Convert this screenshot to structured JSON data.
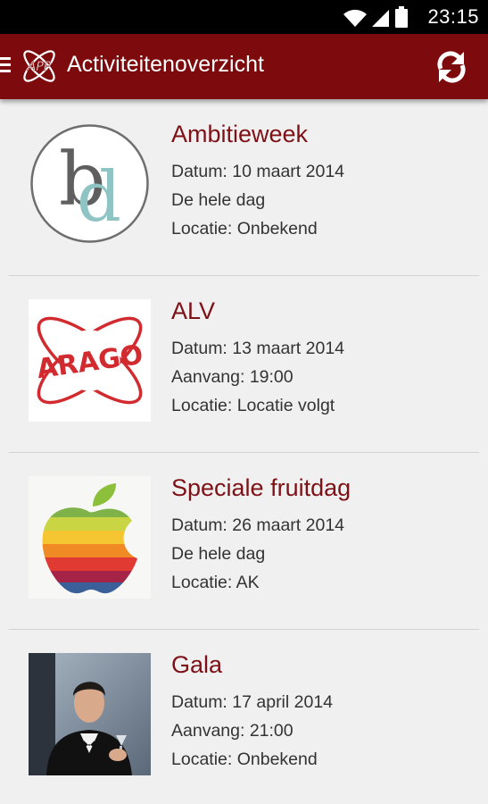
{
  "status_bar": {
    "time": "23:15"
  },
  "action_bar": {
    "title": "Activiteitenoverzicht"
  },
  "activities": [
    {
      "title": "Ambitieweek",
      "line1": "Datum: 10 maart 2014",
      "line2": "De hele dag",
      "line3": "Locatie: Onbekend",
      "image": "bd-logo"
    },
    {
      "title": "ALV",
      "line1": "Datum: 13 maart 2014",
      "line2": "Aanvang: 19:00",
      "line3": "Locatie: Locatie volgt",
      "image": "arago-logo"
    },
    {
      "title": "Speciale fruitdag",
      "line1": "Datum: 26 maart 2014",
      "line2": "De hele dag",
      "line3": "Locatie: AK",
      "image": "fruit-apple-image"
    },
    {
      "title": "Gala",
      "line1": "Datum: 17 april 2014",
      "line2": "Aanvang: 21:00",
      "line3": "Locatie: Onbekend",
      "image": "gala-photo"
    }
  ],
  "colors": {
    "accent": "#7d0b0d",
    "title_text": "#7d1116",
    "background": "#f0f0f0"
  }
}
